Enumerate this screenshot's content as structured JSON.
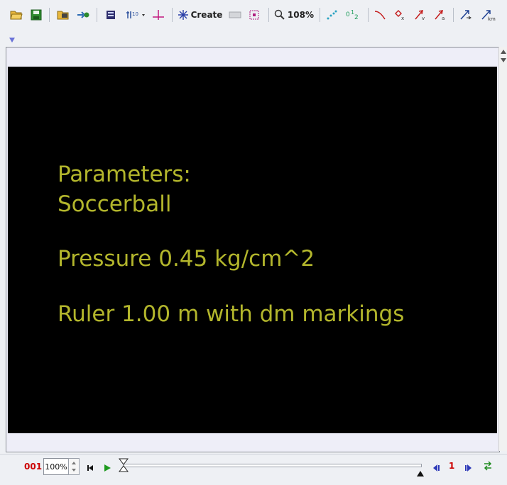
{
  "toolbar": {
    "create_label": "Create",
    "zoom_label": "108%",
    "coords_label": "0 1 2"
  },
  "video": {
    "lines": [
      "Parameters:",
      "Soccerball",
      "Pressure 0.45 kg/cm^2",
      "Ruler 1.00 m with dm markings"
    ]
  },
  "player": {
    "frame_number": "001",
    "zoom_value": "100%",
    "step_value": "1"
  }
}
